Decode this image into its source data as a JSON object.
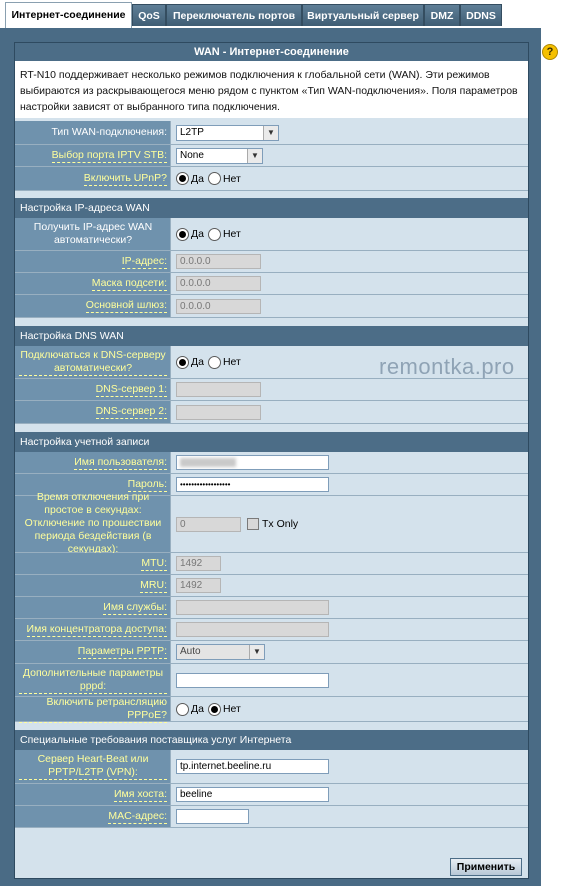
{
  "tabs": {
    "internet": "Интернет-соединение",
    "qos": "QoS",
    "port_switch": "Переключатель портов",
    "virtual_server": "Виртуальный сервер",
    "dmz": "DMZ",
    "ddns": "DDNS"
  },
  "help_icon": "?",
  "header": {
    "title": "WAN - Интернет-соединение",
    "description": "RT-N10 поддерживает несколько режимов подключения к глобальной сети (WAN). Эти режимов выбираются из раскрывающегося меню рядом с пунктом «Тип WAN-подключения». Поля параметров настройки зависят от выбранного типа подключения."
  },
  "basic": {
    "wan_type_label": "Тип WAN-подключения:",
    "wan_type_value": "L2TP",
    "iptv_label": "Выбор порта IPTV STB:",
    "iptv_value": "None",
    "upnp_label": "Включить UPnP?",
    "yes": "Да",
    "no": "Нет"
  },
  "wan_ip": {
    "section": "Настройка IP-адреса WAN",
    "auto_label": "Получить IP-адрес WAN автоматически?",
    "ip_label": "IP-адрес:",
    "ip_value": "0.0.0.0",
    "mask_label": "Маска подсети:",
    "mask_value": "0.0.0.0",
    "gateway_label": "Основной шлюз:",
    "gateway_value": "0.0.0.0"
  },
  "dns": {
    "section": "Настройка DNS WAN",
    "auto_label": "Подключаться к DNS-серверу автоматически?",
    "dns1_label": "DNS-сервер 1:",
    "dns2_label": "DNS-сервер 2:"
  },
  "account": {
    "section": "Настройка учетной записи",
    "username_label": "Имя пользователя:",
    "password_label": "Пароль:",
    "password_value": "••••••••••••••••••",
    "idle_label": "Время отключения при простое в секундах: Отключение по прошествии периода бездействия (в секундах):",
    "idle_value": "0",
    "tx_only": "Tx Only",
    "mtu_label": "MTU:",
    "mtu_value": "1492",
    "mru_label": "MRU:",
    "mru_value": "1492",
    "service_label": "Имя службы:",
    "concentrator_label": "Имя концентратора доступа:",
    "pptp_label": "Параметры PPTP:",
    "pptp_value": "Auto",
    "pppd_label": "Дополнительные параметры pppd:",
    "pppoe_relay_label": "Включить ретрансляцию PPPoE?"
  },
  "isp": {
    "section": "Специальные требования поставщика услуг Интернета",
    "heartbeat_label": "Сервер Heart-Beat или PPTP/L2TP (VPN):",
    "heartbeat_value": "tp.internet.beeline.ru",
    "hostname_label": "Имя хоста:",
    "hostname_value": "beeline",
    "mac_label": "MAC-адрес:"
  },
  "apply_label": "Применить",
  "watermark": "remontka.pro"
}
